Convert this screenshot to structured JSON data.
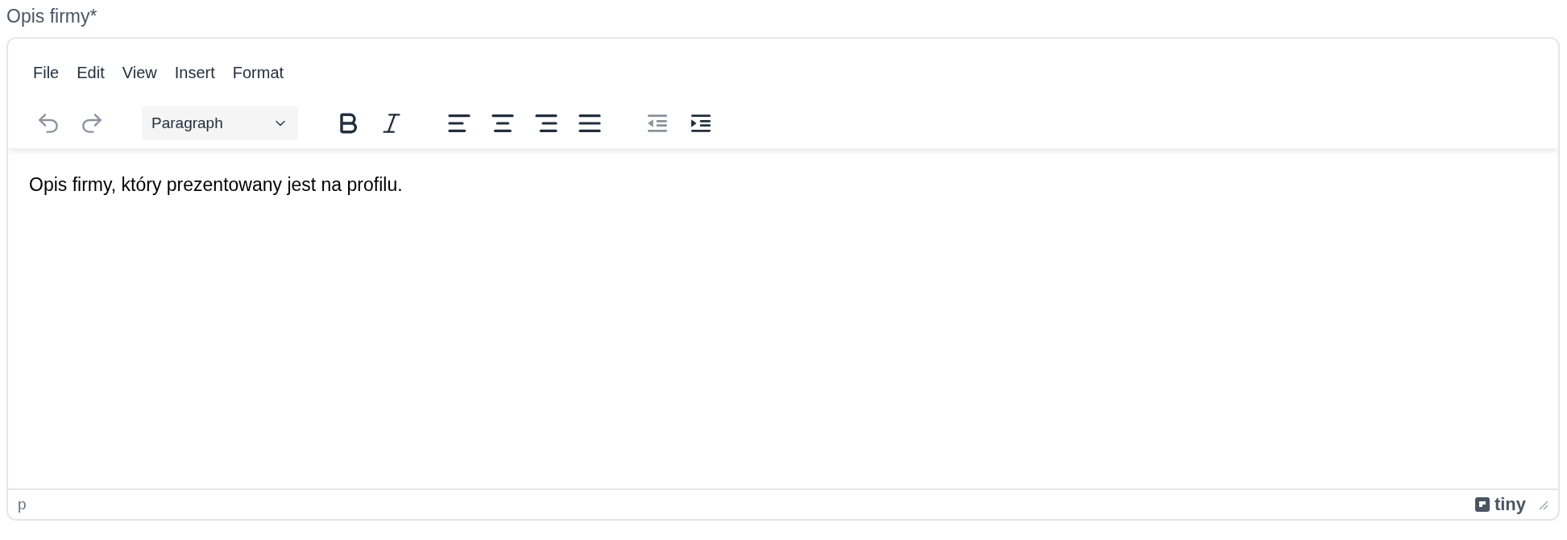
{
  "label": "Opis firmy*",
  "menu": [
    "File",
    "Edit",
    "View",
    "Insert",
    "Format"
  ],
  "toolbar_groups": [
    [
      {
        "kind": "undo",
        "disabled": true
      },
      {
        "kind": "redo",
        "disabled": true
      }
    ],
    [
      {
        "kind": "block",
        "value": "Paragraph"
      }
    ],
    [
      {
        "kind": "bold",
        "disabled": false
      },
      {
        "kind": "italic",
        "disabled": false
      }
    ],
    [
      {
        "kind": "align-left",
        "disabled": false
      },
      {
        "kind": "align-center",
        "disabled": false
      },
      {
        "kind": "align-right",
        "disabled": false
      },
      {
        "kind": "align-justify",
        "disabled": false
      }
    ],
    [
      {
        "kind": "outdent",
        "disabled": true
      },
      {
        "kind": "indent",
        "disabled": false
      }
    ]
  ],
  "content": "Opis firmy, który prezentowany jest na profilu.",
  "status_bar": {
    "path": "p",
    "logo_text": "tiny"
  }
}
